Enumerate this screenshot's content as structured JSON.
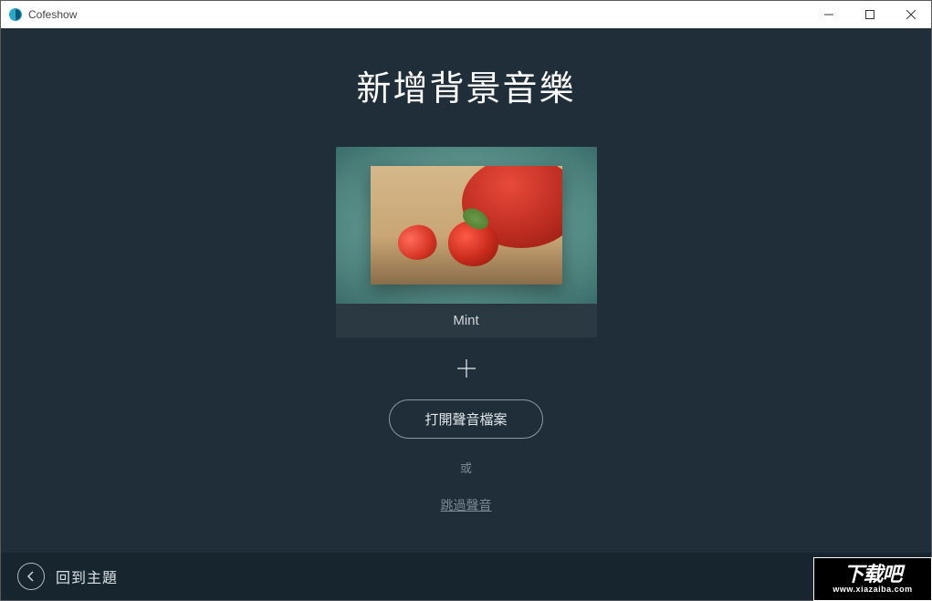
{
  "window": {
    "title": "Cofeshow"
  },
  "main": {
    "heading": "新增背景音樂",
    "preview_label": "Mint",
    "open_button": "打開聲音檔案",
    "or_text": "或",
    "skip_link": "跳過聲音"
  },
  "footer": {
    "back_label": "回到主題"
  },
  "watermark": {
    "main": "下载吧",
    "sub": "www.xiazaiba.com"
  }
}
